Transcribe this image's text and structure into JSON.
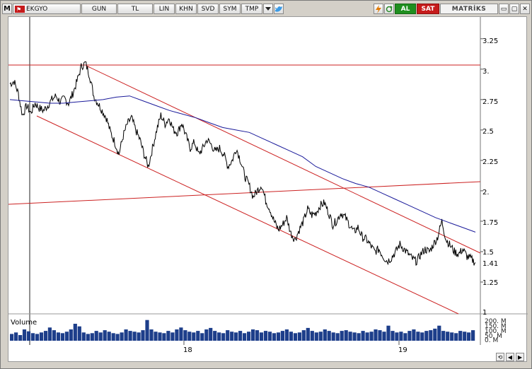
{
  "toolbar": {
    "menu_label": "M",
    "symbol": "EKGYO",
    "buttons": [
      "GUN",
      "TL",
      "LIN",
      "KHN",
      "SVD",
      "SYM",
      "TMP"
    ],
    "al_label": "AL",
    "sat_label": "SAT",
    "brand": "MATRİKS",
    "win_minimize": "▭",
    "win_restore": "▢",
    "win_close": "✕"
  },
  "axis": {
    "y_labels": [
      "3.25",
      "3.",
      "2.75",
      "2.5",
      "2.25",
      "2.",
      "1.75",
      "1.5",
      "1.41",
      "1.25",
      "1"
    ],
    "x_labels": [
      "18",
      "19"
    ],
    "volume_label": "Volume",
    "volume_y_labels": [
      "200. M",
      "150. M",
      "100. M",
      "50. M",
      "0. M"
    ]
  },
  "chart_data": {
    "type": "line",
    "title": "",
    "symbol": "EKGYO",
    "last_price": 1.41,
    "ylim": [
      1.0,
      3.4
    ],
    "y_ticks": [
      1.25,
      1.5,
      1.75,
      2.0,
      2.25,
      2.5,
      2.75,
      3.0,
      3.25
    ],
    "x_tick_labels": [
      "18",
      "19"
    ],
    "colors": {
      "price": "#000000",
      "moving_average": "#1a1a9a",
      "trendlines": "#cc2222",
      "volume": "#1d3e8a"
    },
    "series": [
      {
        "values": [
          2.88,
          2.9,
          2.8,
          2.62,
          2.7,
          2.64,
          2.72,
          2.68,
          2.66,
          2.7,
          2.75,
          2.78,
          2.73,
          2.76,
          2.72,
          2.8,
          2.9,
          3.02,
          3.05,
          2.95,
          2.78,
          2.72,
          2.66,
          2.6,
          2.48,
          2.4,
          2.3,
          2.45,
          2.55,
          2.6,
          2.5,
          2.42,
          2.3,
          2.2,
          2.35,
          2.5,
          2.62,
          2.55,
          2.6,
          2.5,
          2.48,
          2.56,
          2.45,
          2.35,
          2.4,
          2.3,
          2.35,
          2.42,
          2.38,
          2.32,
          2.35,
          2.3,
          2.2,
          2.25,
          2.35,
          2.25,
          2.12,
          2.05,
          1.95,
          2.0,
          2.05,
          1.92,
          1.85,
          1.75,
          1.68,
          1.72,
          1.78,
          1.65,
          1.6,
          1.68,
          1.75,
          1.85,
          1.8,
          1.82,
          1.88,
          1.9,
          1.82,
          1.72,
          1.76,
          1.82,
          1.78,
          1.72,
          1.66,
          1.7,
          1.62,
          1.6,
          1.55,
          1.5,
          1.52,
          1.46,
          1.42,
          1.45,
          1.5,
          1.56,
          1.52,
          1.48,
          1.44,
          1.42,
          1.48,
          1.52,
          1.5,
          1.56,
          1.62,
          1.75,
          1.6,
          1.55,
          1.5,
          1.48,
          1.52,
          1.46,
          1.44,
          1.41
        ]
      },
      {
        "values": [
          2.75,
          2.74,
          2.73,
          2.72,
          2.72,
          2.73,
          2.74,
          2.75,
          2.77,
          2.78,
          2.74,
          2.7,
          2.66,
          2.63,
          2.6,
          2.56,
          2.52,
          2.5,
          2.48,
          2.43,
          2.38,
          2.33,
          2.28,
          2.2,
          2.15,
          2.1,
          2.06,
          2.03,
          1.98,
          1.93,
          1.88,
          1.83,
          1.78,
          1.74,
          1.7,
          1.66
        ]
      }
    ],
    "volume": [
      18,
      22,
      15,
      30,
      25,
      20,
      18,
      22,
      26,
      35,
      28,
      22,
      20,
      24,
      30,
      45,
      38,
      22,
      18,
      20,
      26,
      22,
      28,
      24,
      20,
      18,
      22,
      30,
      26,
      24,
      22,
      28,
      55,
      30,
      24,
      22,
      20,
      26,
      22,
      30,
      35,
      28,
      24,
      22,
      26,
      20,
      30,
      34,
      26,
      22,
      20,
      28,
      24,
      22,
      26,
      20,
      24,
      30,
      28,
      22,
      26,
      24,
      20,
      22,
      26,
      30,
      24,
      20,
      22,
      28,
      34,
      26,
      22,
      24,
      30,
      26,
      22,
      20,
      26,
      28,
      24,
      22,
      20,
      26,
      22,
      24,
      30,
      28,
      24,
      40,
      26,
      22,
      24,
      20,
      26,
      30,
      24,
      22,
      26,
      28,
      32,
      40,
      26,
      24,
      22,
      20,
      26,
      24,
      22,
      28
    ]
  }
}
